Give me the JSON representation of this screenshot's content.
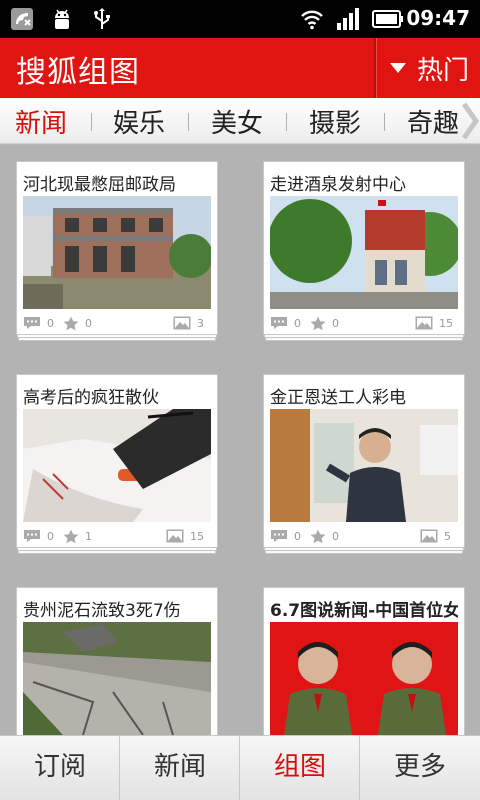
{
  "status_bar": {
    "time": "09:47",
    "icons": [
      "phone-missed-icon",
      "android-debug-icon",
      "usb-icon",
      "wifi-icon",
      "signal-icon",
      "battery-icon"
    ]
  },
  "header": {
    "title": "搜狐组图",
    "filter_label": "热门",
    "accent_color": "#e01410"
  },
  "tabs": [
    {
      "label": "新闻",
      "active": true
    },
    {
      "label": "娱乐",
      "active": false
    },
    {
      "label": "美女",
      "active": false
    },
    {
      "label": "摄影",
      "active": false
    },
    {
      "label": "奇趣",
      "active": false
    }
  ],
  "cards": [
    {
      "title": "河北现最憋屈邮政局",
      "comments": "0",
      "favorites": "0",
      "photos": "3"
    },
    {
      "title": "走进酒泉发射中心",
      "comments": "0",
      "favorites": "0",
      "photos": "15"
    },
    {
      "title": "高考后的疯狂散伙",
      "comments": "0",
      "favorites": "1",
      "photos": "15"
    },
    {
      "title": "金正恩送工人彩电",
      "comments": "0",
      "favorites": "0",
      "photos": "5"
    },
    {
      "title": "贵州泥石流致3死7伤",
      "comments": "",
      "favorites": "",
      "photos": ""
    },
    {
      "title": "6.7图说新闻-中国首位女",
      "comments": "",
      "favorites": "",
      "photos": ""
    }
  ],
  "bottom_nav": [
    {
      "label": "订阅",
      "active": false
    },
    {
      "label": "新闻",
      "active": false
    },
    {
      "label": "组图",
      "active": true
    },
    {
      "label": "更多",
      "active": false
    }
  ]
}
